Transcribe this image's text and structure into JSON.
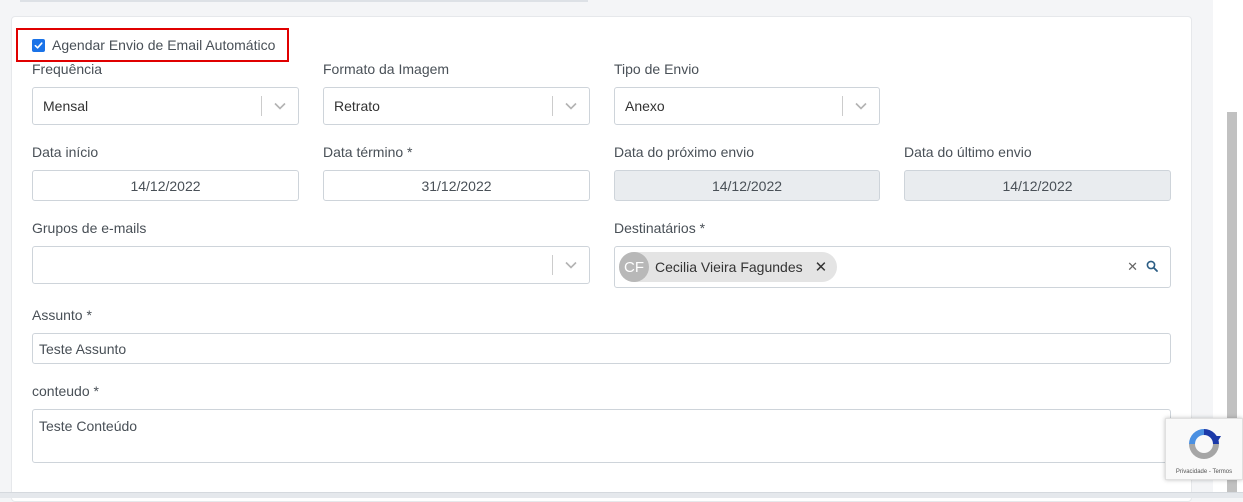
{
  "schedule": {
    "checkbox_label": "Agendar Envio de Email Automático",
    "checked": true
  },
  "fields": {
    "frequency": {
      "label": "Frequência",
      "value": "Mensal"
    },
    "image_format": {
      "label": "Formato da Imagem",
      "value": "Retrato"
    },
    "send_type": {
      "label": "Tipo de Envio",
      "value": "Anexo"
    },
    "start_date": {
      "label": "Data início",
      "value": "14/12/2022"
    },
    "end_date": {
      "label": "Data término *",
      "value": "31/12/2022"
    },
    "next_send": {
      "label": "Data do próximo envio",
      "value": "14/12/2022"
    },
    "last_send": {
      "label": "Data do último envio",
      "value": "14/12/2022"
    },
    "email_groups": {
      "label": "Grupos de e-mails",
      "value": ""
    },
    "recipients": {
      "label": "Destinatários *",
      "chips": [
        {
          "initials": "CF",
          "name": "Cecilia Vieira Fagundes"
        }
      ]
    },
    "subject": {
      "label": "Assunto *",
      "value": "Teste Assunto"
    },
    "content": {
      "label": "conteudo *",
      "value": "Teste Conteúdo"
    }
  },
  "recaptcha": {
    "links": "Privacidade - Termos"
  },
  "colors": {
    "checkbox": "#1a73e8",
    "highlight_border": "#e00000",
    "readonly_bg": "#e9ecef"
  },
  "icons": [
    "check-icon",
    "chevron-down-icon",
    "remove-chip-icon",
    "clear-icon",
    "search-icon",
    "recaptcha-logo-icon"
  ]
}
